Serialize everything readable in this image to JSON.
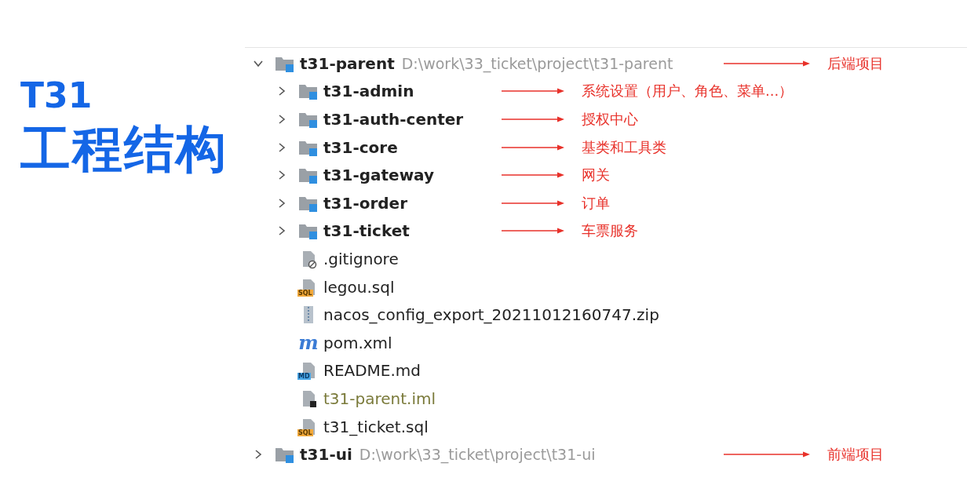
{
  "title": {
    "code": "T31",
    "name": "工程结构"
  },
  "tree": [
    {
      "kind": "module",
      "name": "t31-parent",
      "path": "D:\\work\\33_ticket\\project\\t31-parent",
      "expanded": true,
      "note": "后端项目",
      "children": [
        {
          "kind": "module",
          "name": "t31-admin",
          "expanded": false,
          "note": "系统设置（用户、角色、菜单...）"
        },
        {
          "kind": "module",
          "name": "t31-auth-center",
          "expanded": false,
          "note": "授权中心"
        },
        {
          "kind": "module",
          "name": "t31-core",
          "expanded": false,
          "note": "基类和工具类"
        },
        {
          "kind": "module",
          "name": "t31-gateway",
          "expanded": false,
          "note": "网关"
        },
        {
          "kind": "module",
          "name": "t31-order",
          "expanded": false,
          "note": "订单"
        },
        {
          "kind": "module",
          "name": "t31-ticket",
          "expanded": false,
          "note": "车票服务"
        },
        {
          "kind": "ignore",
          "name": ".gitignore"
        },
        {
          "kind": "sql",
          "name": "legou.sql",
          "badge": "SQL"
        },
        {
          "kind": "zip",
          "name": "nacos_config_export_20211012160747.zip"
        },
        {
          "kind": "maven",
          "name": "pom.xml",
          "badge": "m"
        },
        {
          "kind": "md",
          "name": "README.md",
          "badge": "MD"
        },
        {
          "kind": "iml",
          "name": "t31-parent.iml",
          "dimmed": true
        },
        {
          "kind": "sql",
          "name": "t31_ticket.sql",
          "badge": "SQL"
        }
      ]
    },
    {
      "kind": "module",
      "name": "t31-ui",
      "path": "D:\\work\\33_ticket\\project\\t31-ui",
      "expanded": false,
      "note": "前端项目"
    }
  ]
}
